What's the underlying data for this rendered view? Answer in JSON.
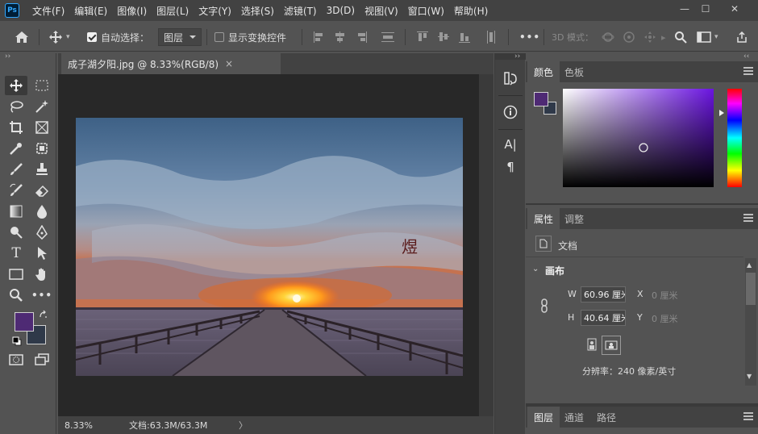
{
  "app": {
    "logo": "Ps"
  },
  "menu": [
    "文件(F)",
    "编辑(E)",
    "图像(I)",
    "图层(L)",
    "文字(Y)",
    "选择(S)",
    "滤镜(T)",
    "3D(D)",
    "视图(V)",
    "窗口(W)",
    "帮助(H)"
  ],
  "window_controls": {
    "minimize": "—",
    "maximize": "☐",
    "close": "✕"
  },
  "options_bar": {
    "auto_select_label": "自动选择：",
    "auto_select_checked": true,
    "auto_select_target": "图层",
    "show_transform_label": "显示变换控件",
    "show_transform_checked": false,
    "more": "•••",
    "mode_3d_label": "3D 模式："
  },
  "document": {
    "tab_title": "成子湖夕阳.jpg @ 8.33%(RGB/8)",
    "close": "×",
    "status_zoom": "8.33%",
    "status_doc": "文档:63.3M/63.3M",
    "status_arrow": "〉",
    "watermark_glyph": "煜"
  },
  "panels": {
    "collapse_glyph": "‹‹",
    "expand_glyph": "››",
    "color_tabs": [
      "颜色",
      "色板"
    ],
    "properties_tabs": [
      "属性",
      "调整"
    ],
    "doc_label": "文档",
    "canvas_section": "画布",
    "w_label": "W",
    "w_value": "60.96 厘米",
    "x_label": "X",
    "x_value": "0 厘米",
    "h_label": "H",
    "h_value": "40.64 厘米",
    "y_label": "Y",
    "y_value": "0 厘米",
    "resolution": "分辨率：240 像素/英寸",
    "layers_tabs": [
      "图层",
      "通道",
      "路径"
    ]
  },
  "mid_strip": {
    "char_icon": "A|",
    "para_icon": "¶",
    "info_icon": "i"
  },
  "colors": {
    "foreground": "#4e2a74",
    "background": "#2f3949",
    "picker_hue": "#6a14e0"
  },
  "icons": [
    "home-icon",
    "move-icon",
    "marquee-icon",
    "lasso-icon",
    "magic-wand-icon",
    "crop-icon",
    "frame-icon",
    "eyedropper-icon",
    "healing-icon",
    "brush-icon",
    "stamp-icon",
    "history-brush-icon",
    "eraser-icon",
    "gradient-icon",
    "blur-icon",
    "dodge-icon",
    "pen-icon",
    "type-icon",
    "path-select-icon",
    "rectangle-icon",
    "hand-icon",
    "zoom-icon",
    "more-tools-icon",
    "swap-colors-icon",
    "default-colors-icon",
    "quick-mask-icon",
    "screen-mode-icon",
    "search-icon",
    "link-icon"
  ]
}
